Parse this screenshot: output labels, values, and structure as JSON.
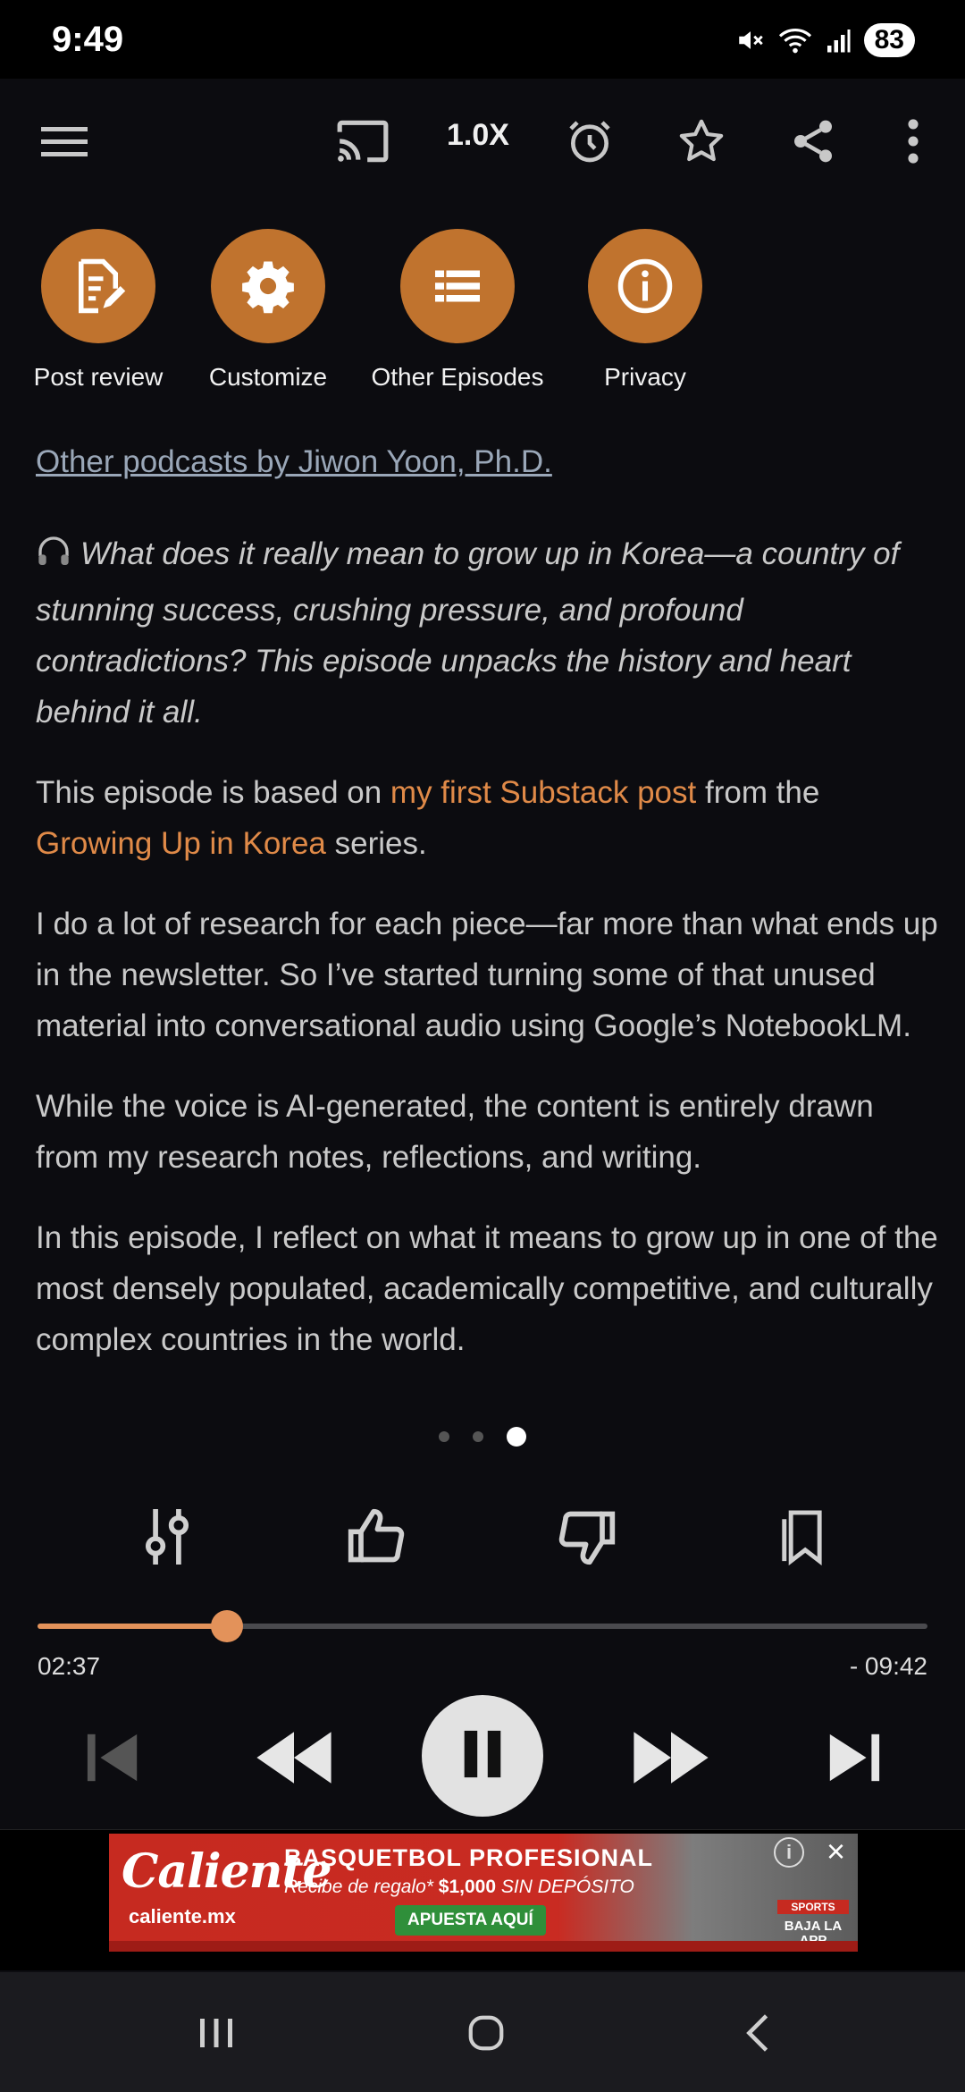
{
  "status": {
    "time": "9:49",
    "battery": "83"
  },
  "toolbar": {
    "speed": "1.0X"
  },
  "actions": [
    {
      "label": "Post review",
      "icon": "post-review-icon"
    },
    {
      "label": "Customize",
      "icon": "gear-icon"
    },
    {
      "label": "Other Episodes",
      "icon": "list-icon"
    },
    {
      "label": "Privacy",
      "icon": "info-icon"
    }
  ],
  "description": {
    "other_podcasts": "Other podcasts by Jiwon Yoon, Ph.D.",
    "intro": "What does it really mean to grow up in Korea—a country of stunning success, crushing pressure, and profound contradictions? This episode unpacks the history and heart behind it all.",
    "p1_before": "This episode is based on ",
    "p1_link1": "my first Substack post",
    "p1_middle": " from the ",
    "p1_link2": "Growing Up in Korea",
    "p1_after": " series.",
    "p2": "I do a lot of research for each piece—far more than what ends up in the newsletter. So I’ve started turning some of that unused material into conversational audio using Google’s NotebookLM.",
    "p3": "While the voice is AI-generated, the content is entirely drawn from my research notes, reflections, and writing.",
    "p4": "In this episode, I reflect on what it means to grow up in one of the most densely populated, academically competitive, and culturally complex countries in the world."
  },
  "player": {
    "progress": 0.213,
    "elapsed": "02:37",
    "remaining": "- 09:42",
    "page_dots": 3,
    "active_dot": 2
  },
  "ad": {
    "brand": "Caliente",
    "site": "caliente.mx",
    "headline": "BASQUETBOL PROFESIONAL",
    "sub_a": "Recibe de regalo* ",
    "sub_amount": "$1,000",
    "sub_b": " SIN DEPÓSITO",
    "cta": "APUESTA AQUÍ",
    "app": "BAJA LA APP",
    "sports_tag": "SPORTS"
  },
  "colors": {
    "accent": "#c0732e",
    "link": "#e08a48",
    "progress": "#e3925a",
    "background": "#0c0c10"
  }
}
